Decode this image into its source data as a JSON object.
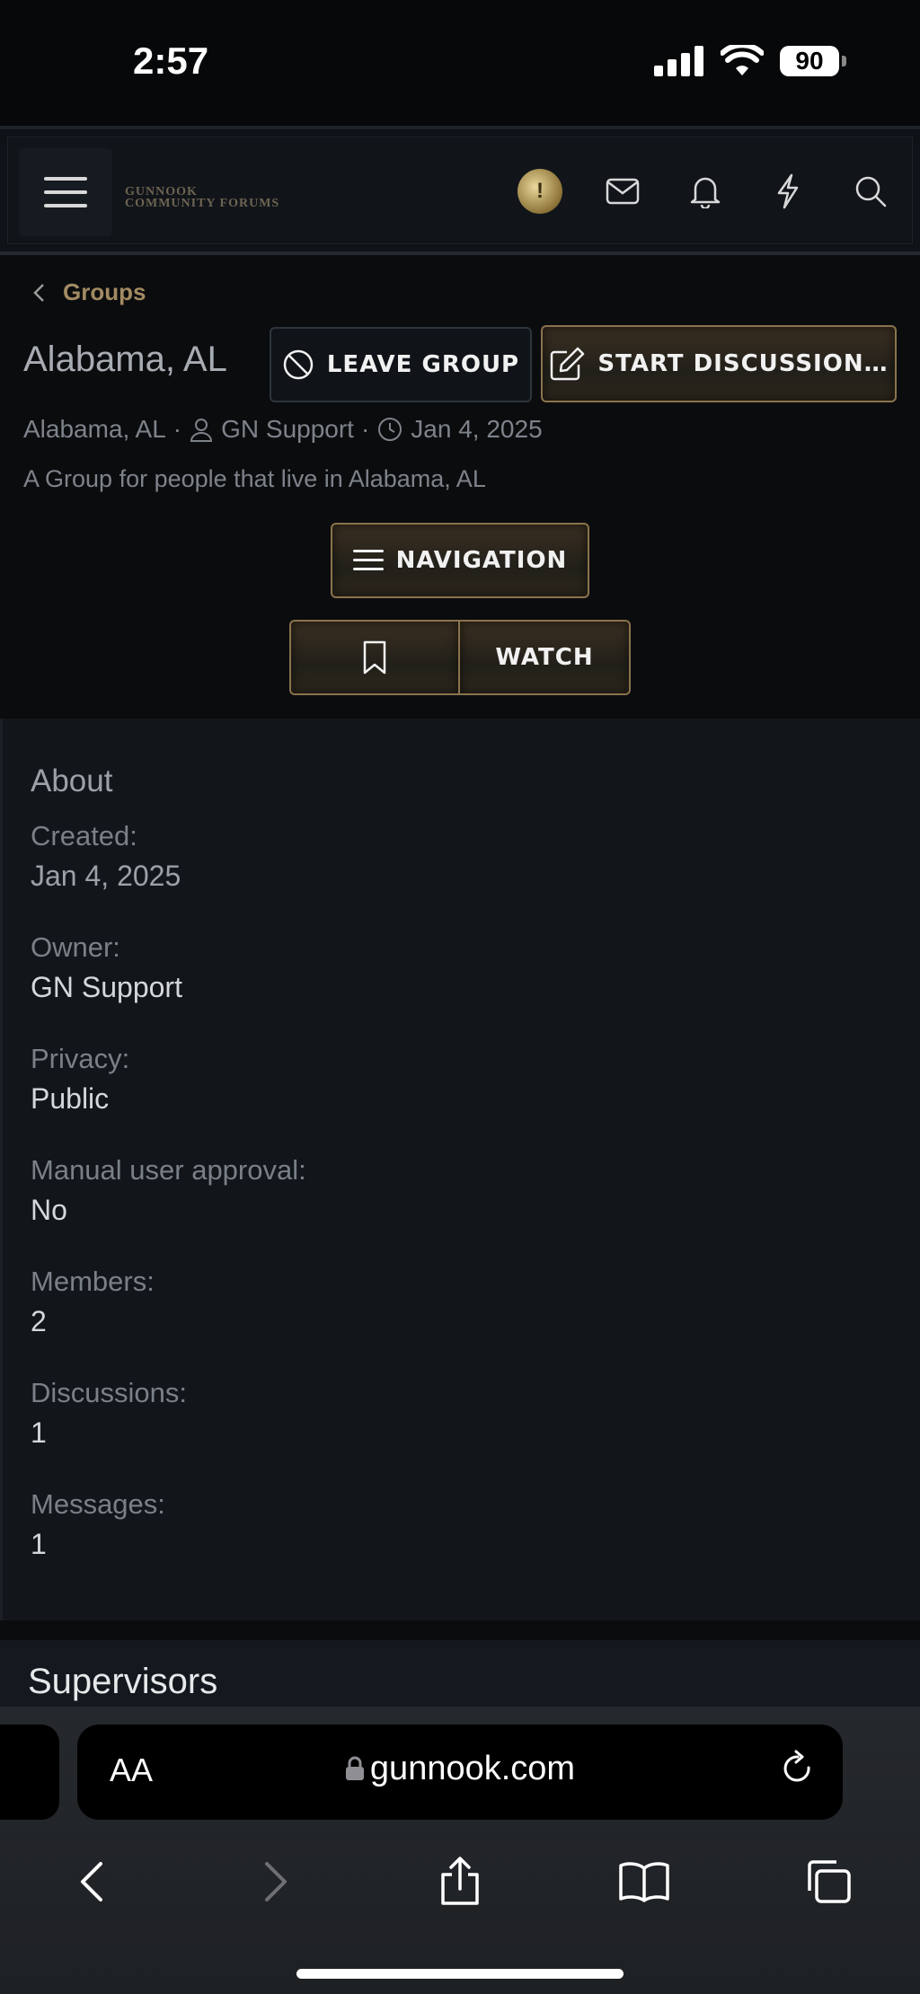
{
  "status_bar": {
    "time": "2:57",
    "battery": "90"
  },
  "header": {
    "logo_line1": "GUNNOOK",
    "logo_line2": "COMMUNITY FORUMS",
    "icons": [
      "menu-icon",
      "avatar",
      "envelope-icon",
      "bell-icon",
      "lightning-icon",
      "search-icon"
    ]
  },
  "breadcrumb": {
    "label": "Groups"
  },
  "group": {
    "title": "Alabama, AL",
    "leave_label": "LEAVE GROUP",
    "start_label": "START DISCUSSION…",
    "meta_name": "Alabama, AL",
    "meta_owner": "GN Support",
    "meta_date": "Jan 4, 2025",
    "description": "A Group for people that live in Alabama, AL",
    "nav_label": "NAVIGATION",
    "watch_label": "WATCH"
  },
  "about": {
    "title": "About",
    "rows": [
      {
        "label": "Created:",
        "value": "Jan 4, 2025"
      },
      {
        "label": "Owner:",
        "value": "GN Support"
      },
      {
        "label": "Privacy:",
        "value": "Public"
      },
      {
        "label": "Manual user approval:",
        "value": "No"
      },
      {
        "label": "Members:",
        "value": "2"
      },
      {
        "label": "Discussions:",
        "value": "1"
      },
      {
        "label": "Messages:",
        "value": "1"
      }
    ]
  },
  "supervisors": {
    "title": "Supervisors"
  },
  "browser": {
    "aa": "AA",
    "url": "gunnook.com"
  },
  "colors": {
    "accent_gold": "#a28a62",
    "button_border": "#8a734d",
    "background": "#0b0c0e"
  }
}
